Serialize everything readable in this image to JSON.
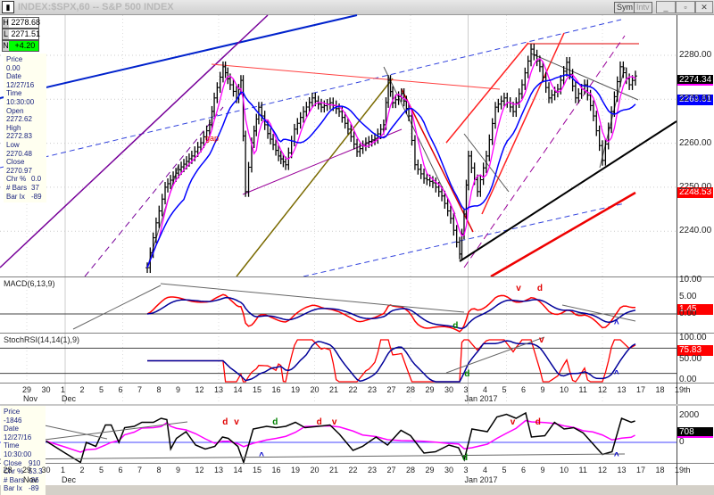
{
  "window": {
    "title": "INDEX:$SPX,60 -- S&P 500 INDEX",
    "sym_button": "Sym",
    "intv_button": "Intv",
    "minimize": "_",
    "restore": "▫",
    "close": "✕"
  },
  "ohl": {
    "h_label": "H",
    "h": "2278.68",
    "l_label": "L",
    "l": "2271.51",
    "n_label": "N",
    "n": "+4.20"
  },
  "info": [
    [
      "Price",
      "0.00"
    ],
    [
      "Date",
      "12/27/16"
    ],
    [
      "Time",
      "10:30:00"
    ],
    [
      "Open",
      "2272.62"
    ],
    [
      "High",
      "2272.83"
    ],
    [
      "Low",
      "2270.48"
    ],
    [
      "Close",
      "2270.97"
    ],
    [
      "Chr %",
      "0.0"
    ],
    [
      "# Bars",
      "37"
    ],
    [
      "Bar Ix",
      "-89"
    ]
  ],
  "info2": [
    [
      "Price",
      "-1846"
    ],
    [
      "Date",
      "12/27/16"
    ],
    [
      "Time",
      "10:30:00"
    ],
    [
      "Close",
      "910"
    ],
    [
      "Chr %",
      "53.3"
    ],
    [
      "# Bars",
      "-86"
    ],
    [
      "Bar Ix",
      "-89"
    ]
  ],
  "tags": {
    "last": "2274.34",
    "ma_blue": "2269.61",
    "ma_red": "2248.53",
    "macd": "1.45",
    "stoch": "75.83",
    "breadth": "708"
  },
  "colors": {
    "price": "#000000",
    "ma_fast": "#ff00ff",
    "ma_mid": "#0000ff",
    "ma_slow": "#ff0000",
    "up_value": "#00ff00"
  },
  "chart_data": {
    "type": "line",
    "title": "INDEX:$SPX,60 -- S&P 500 INDEX",
    "x_unit": "trading day index (0 = Nov 29)",
    "price_axis": {
      "ticks": [
        "2280.00",
        "2270.00",
        "2260.00",
        "2250.00",
        "2240.00"
      ],
      "values": [
        2280,
        2270,
        2260,
        2250,
        2240
      ]
    },
    "price": [
      [
        6.28,
        2231.7
      ],
      [
        6.74,
        2241.9
      ],
      [
        7.21,
        2250.0
      ],
      [
        7.91,
        2254.0
      ],
      [
        8.6,
        2257.1
      ],
      [
        9.07,
        2260.1
      ],
      [
        9.53,
        2264.2
      ],
      [
        9.77,
        2270.3
      ],
      [
        10.23,
        2277.4
      ],
      [
        10.6,
        2273.3
      ],
      [
        10.93,
        2270.3
      ],
      [
        11.16,
        2274.3
      ],
      [
        11.4,
        2249.0
      ],
      [
        11.72,
        2260.1
      ],
      [
        12.09,
        2268.2
      ],
      [
        12.56,
        2262.2
      ],
      [
        13.12,
        2257.1
      ],
      [
        13.49,
        2255.1
      ],
      [
        13.95,
        2263.2
      ],
      [
        14.42,
        2267.2
      ],
      [
        14.88,
        2270.3
      ],
      [
        15.35,
        2268.2
      ],
      [
        15.81,
        2269.2
      ],
      [
        16.28,
        2267.2
      ],
      [
        16.74,
        2263.2
      ],
      [
        17.21,
        2258.1
      ],
      [
        17.67,
        2260.1
      ],
      [
        18.14,
        2261.1
      ],
      [
        18.6,
        2264.2
      ],
      [
        18.84,
        2274.3
      ],
      [
        19.07,
        2269.2
      ],
      [
        19.53,
        2271.3
      ],
      [
        19.91,
        2266.2
      ],
      [
        20.23,
        2255.1
      ],
      [
        20.7,
        2252.0
      ],
      [
        21.16,
        2251.0
      ],
      [
        21.63,
        2248.0
      ],
      [
        22.09,
        2242.9
      ],
      [
        22.56,
        2234.8
      ],
      [
        22.79,
        2243.9
      ],
      [
        23.02,
        2257.1
      ],
      [
        23.49,
        2249.0
      ],
      [
        23.95,
        2257.1
      ],
      [
        24.42,
        2268.2
      ],
      [
        24.88,
        2270.3
      ],
      [
        25.35,
        2267.2
      ],
      [
        25.81,
        2273.3
      ],
      [
        26.28,
        2281.4
      ],
      [
        26.74,
        2277.4
      ],
      [
        27.21,
        2270.3
      ],
      [
        27.67,
        2272.3
      ],
      [
        28.14,
        2278.4
      ],
      [
        28.6,
        2270.3
      ],
      [
        29.07,
        2273.3
      ],
      [
        29.53,
        2266.2
      ],
      [
        30.0,
        2256.1
      ],
      [
        30.47,
        2267.2
      ],
      [
        30.93,
        2277.4
      ],
      [
        31.4,
        2273.3
      ],
      [
        31.72,
        2275.3
      ]
    ],
    "macd": {
      "label": "MACD(6,13,9)",
      "ticks": [
        "10.00",
        "5.00",
        "0.00"
      ],
      "values": [
        10,
        5,
        0
      ]
    },
    "stochrsi": {
      "label": "StochRSI(14,14(1),9)",
      "ticks": [
        "100.00",
        "50.00",
        "0.00"
      ],
      "values": [
        100,
        50,
        0
      ]
    },
    "breadth": {
      "ticks": [
        "2000",
        "0"
      ],
      "values": [
        2000,
        0
      ],
      "series": [
        [
          1,
          100
        ],
        [
          2,
          -800
        ],
        [
          2.8,
          -1500
        ],
        [
          3.1,
          0
        ],
        [
          3.6,
          -300
        ],
        [
          4.1,
          1300
        ],
        [
          4.4,
          1300
        ],
        [
          4.8,
          0
        ],
        [
          5.1,
          1100
        ],
        [
          5.6,
          1200
        ],
        [
          6,
          1500
        ],
        [
          6.6,
          1500
        ],
        [
          7,
          1800
        ],
        [
          7.3,
          1700
        ],
        [
          7.5,
          -500
        ],
        [
          7.8,
          300
        ],
        [
          8.3,
          800
        ],
        [
          8.8,
          -200
        ],
        [
          9.3,
          -500
        ],
        [
          9.8,
          -300
        ],
        [
          10.2,
          400
        ],
        [
          10.5,
          300
        ],
        [
          11,
          -300
        ],
        [
          11.3,
          -1500
        ],
        [
          11.8,
          1000
        ],
        [
          12.5,
          1200
        ],
        [
          13,
          1100
        ],
        [
          13.5,
          1200
        ],
        [
          14,
          1500
        ],
        [
          14.5,
          1100
        ],
        [
          15.2,
          1200
        ],
        [
          15.8,
          1300
        ],
        [
          16.3,
          600
        ],
        [
          17,
          -600
        ],
        [
          17.5,
          -300
        ],
        [
          18.2,
          400
        ],
        [
          18.8,
          -200
        ],
        [
          19.5,
          900
        ],
        [
          20,
          500
        ],
        [
          20.7,
          -800
        ],
        [
          21.3,
          -700
        ],
        [
          22,
          -200
        ],
        [
          22.5,
          -400
        ],
        [
          22.8,
          -1300
        ],
        [
          23.2,
          1000
        ],
        [
          24,
          800
        ],
        [
          24.5,
          1900
        ],
        [
          25,
          2100
        ],
        [
          25.5,
          1800
        ],
        [
          26,
          2200
        ],
        [
          26.3,
          400
        ],
        [
          27,
          500
        ],
        [
          27.5,
          1500
        ],
        [
          28,
          1000
        ],
        [
          28.5,
          1100
        ],
        [
          29,
          700
        ],
        [
          29.5,
          -100
        ],
        [
          30,
          -900
        ],
        [
          30.5,
          -700
        ],
        [
          31,
          1800
        ],
        [
          31.5,
          1500
        ],
        [
          31.7,
          1600
        ]
      ]
    },
    "x_labels": [
      "29",
      "30",
      "1",
      "2",
      "5",
      "6",
      "7",
      "8",
      "9",
      "12",
      "13",
      "14",
      "15",
      "16",
      "19",
      "20",
      "21",
      "22",
      "23",
      "27",
      "28",
      "29",
      "30",
      "3",
      "4",
      "5",
      "6",
      "9",
      "10",
      "11",
      "12",
      "13",
      "17",
      "18",
      "19th"
    ],
    "month_labels": [
      {
        "text": "Nov",
        "at": 0
      },
      {
        "text": "Dec",
        "at": 2
      },
      {
        "text": "Jan 2017",
        "at": 23
      }
    ],
    "lower_x_labels": [
      "28",
      "29",
      "30",
      "1",
      "2",
      "5",
      "6",
      "7",
      "8",
      "9",
      "12",
      "13",
      "14",
      "15",
      "16",
      "19",
      "20",
      "21",
      "22",
      "23",
      "27",
      "28",
      "29",
      "30",
      "3",
      "4",
      "5",
      "6",
      "9",
      "10",
      "11",
      "12",
      "13",
      "17",
      "18",
      "19th"
    ],
    "annotations": {
      "gap": "gap",
      "macd": [
        {
          "t": "v",
          "at": 25.5,
          "c": "#e00000"
        },
        {
          "t": "d",
          "at": 26.6,
          "c": "#e00000"
        },
        {
          "t": "d",
          "at": 22.2,
          "c": "#008000"
        },
        {
          "t": "^",
          "at": 30.6,
          "c": "#0000cc"
        }
      ],
      "stoch": [
        {
          "t": "v",
          "at": 26.7,
          "c": "#e00000"
        },
        {
          "t": "d",
          "at": 22.8,
          "c": "#008000"
        },
        {
          "t": "^",
          "at": 30.6,
          "c": "#0000cc"
        }
      ],
      "breadth": [
        {
          "t": "d",
          "at": 10.2,
          "c": "#e00000"
        },
        {
          "t": "v",
          "at": 10.8,
          "c": "#e00000"
        },
        {
          "t": "d",
          "at": 12.8,
          "c": "#008000"
        },
        {
          "t": "d",
          "at": 15.1,
          "c": "#e00000"
        },
        {
          "t": "v",
          "at": 15.9,
          "c": "#e00000"
        },
        {
          "t": "d",
          "at": 22.7,
          "c": "#008000"
        },
        {
          "t": "v",
          "at": 25.2,
          "c": "#e00000"
        },
        {
          "t": "d",
          "at": 26.5,
          "c": "#e00000"
        },
        {
          "t": "^",
          "at": 12.1,
          "c": "#0000cc"
        },
        {
          "t": "^",
          "at": 30.6,
          "c": "#0000cc"
        }
      ]
    }
  }
}
